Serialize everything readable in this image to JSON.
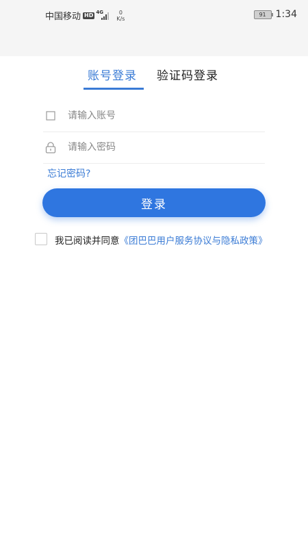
{
  "status_bar": {
    "carrier": "中国移动",
    "hd_badge": "HD",
    "network": "4G",
    "speed_value": "0",
    "speed_unit": "K/s",
    "battery": "91",
    "time": "1:34"
  },
  "tabs": [
    {
      "label": "账号登录",
      "active": true
    },
    {
      "label": "验证码登录",
      "active": false
    }
  ],
  "form": {
    "account_placeholder": "请输入账号",
    "password_placeholder": "请输入密码",
    "forgot_label": "忘记密码?",
    "login_label": "登录"
  },
  "agreement": {
    "prefix": "我已阅读并同意",
    "link": "《团巴巴用户服务协议与隐私政策》",
    "checked": false
  },
  "colors": {
    "accent": "#3a7bd5",
    "button": "#2f76e0"
  }
}
